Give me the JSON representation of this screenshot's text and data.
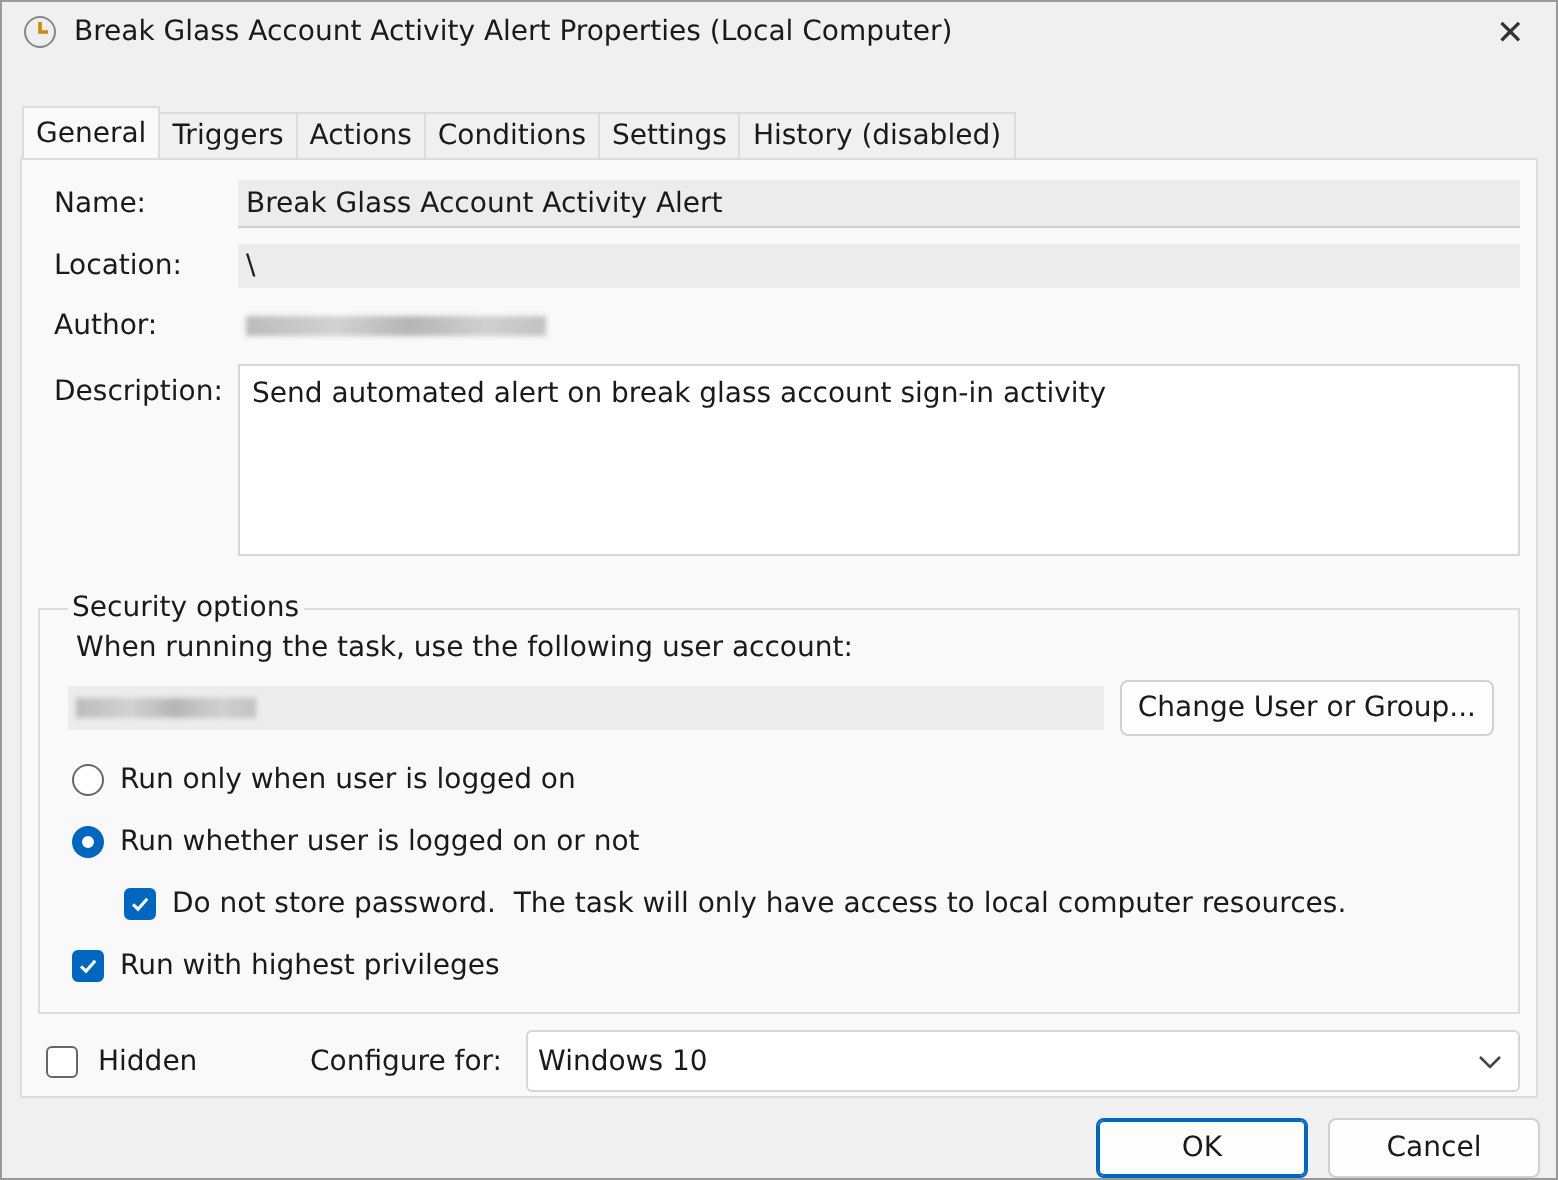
{
  "window": {
    "title": "Break Glass Account Activity Alert Properties (Local Computer)",
    "close": "✕"
  },
  "tabs": [
    {
      "label": "General",
      "selected": true
    },
    {
      "label": "Triggers",
      "selected": false
    },
    {
      "label": "Actions",
      "selected": false
    },
    {
      "label": "Conditions",
      "selected": false
    },
    {
      "label": "Settings",
      "selected": false
    },
    {
      "label": "History (disabled)",
      "selected": false
    }
  ],
  "general": {
    "name_label": "Name:",
    "name": "Break Glass Account Activity Alert",
    "location_label": "Location:",
    "location": "\\",
    "author_label": "Author:",
    "description_label": "Description:",
    "description": "Send automated alert on break glass account sign-in activity"
  },
  "security": {
    "title": "Security options",
    "account_label": "When running the task, use the following user account:",
    "change_button": "Change User or Group...",
    "options": [
      {
        "kind": "radio",
        "label": "Run only when user is logged on",
        "selected": false,
        "indented": false
      },
      {
        "kind": "radio",
        "label": "Run whether user is logged on or not",
        "selected": true,
        "indented": false
      },
      {
        "kind": "checkbox",
        "label": "Do not store password.  The task will only have access to local computer resources.",
        "checked": true,
        "indented": true
      },
      {
        "kind": "checkbox",
        "label": "Run with highest privileges",
        "checked": true,
        "indented": false
      }
    ]
  },
  "hidden": {
    "label": "Hidden",
    "checked": false
  },
  "configure": {
    "label": "Configure for:",
    "value": "Windows 10"
  },
  "buttons": [
    {
      "label": "OK",
      "default": true
    },
    {
      "label": "Cancel",
      "default": false
    }
  ]
}
